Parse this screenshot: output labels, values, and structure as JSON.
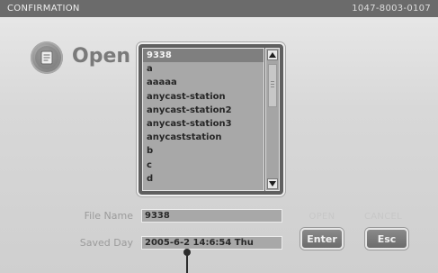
{
  "titlebar": {
    "title": "CONFIRMATION",
    "code": "1047-8003-0107"
  },
  "header": {
    "open_label": "Open",
    "icon": "document-icon"
  },
  "list": {
    "items": [
      "9338",
      "a",
      "aaaaa",
      "anycast-station",
      "anycast-station2",
      "anycast-station3",
      "anycaststation",
      "b",
      "c",
      "d"
    ],
    "selected_index": 0
  },
  "fields": {
    "file_name_label": "File Name",
    "file_name_value": "9338",
    "saved_day_label": "Saved Day",
    "saved_day_value": "2005-6-2 14:6:54 Thu"
  },
  "actions": {
    "open_label": "OPEN",
    "enter_button": "Enter",
    "cancel_label": "CANCEL",
    "esc_button": "Esc"
  },
  "colors": {
    "titlebar": "#6b6b6b",
    "list_bg": "#a8a8a8",
    "selected_bg": "#7f7f7f",
    "button": "#7a7a7a"
  }
}
